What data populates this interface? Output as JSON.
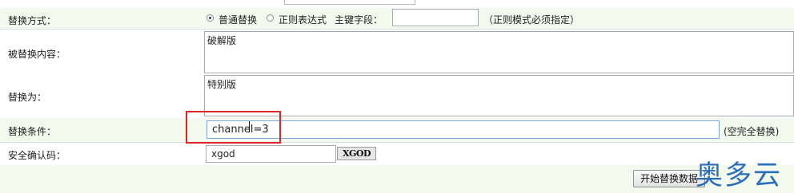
{
  "rows": {
    "replace_mode": {
      "label": "替换方式：",
      "option_normal": "普通替换",
      "option_regex": "正则表达式",
      "primary_key_label": "主键字段：",
      "primary_key_value": "",
      "hint": "（正则模式必须指定）"
    },
    "replaced_content": {
      "label": "被替换内容：",
      "value": "破解版"
    },
    "replace_with": {
      "label": "替换为：",
      "value": "特别版"
    },
    "condition": {
      "label": "替换条件：",
      "value": "channel=3",
      "hint": "(空完全替换)"
    },
    "captcha": {
      "label": "安全确认码：",
      "value": "xgod",
      "image_text": "XGOD"
    }
  },
  "actions": {
    "start_label": "开始替换数据"
  },
  "watermark": "奥多云",
  "colors": {
    "row_tint": "#f4f9ee",
    "highlight_border": "#e0242b",
    "active_input_border": "#7ba7d9",
    "watermark": "#2a6fb8"
  },
  "icons": [
    "radio-checked-icon",
    "radio-unchecked-icon",
    "text-caret-icon"
  ]
}
